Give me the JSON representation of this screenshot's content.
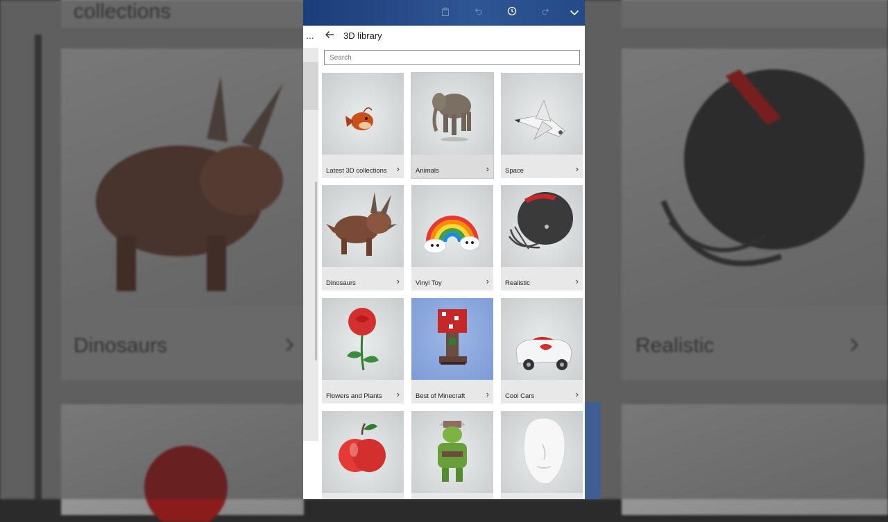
{
  "background": {
    "left_label_top": "collections",
    "left_label": "Dinosaurs",
    "right_label": "Realistic"
  },
  "toolbar": {
    "icons": [
      "paste-icon",
      "undo-icon",
      "history-icon",
      "redo-icon",
      "chevron-down-icon"
    ]
  },
  "panel": {
    "more_label": "...",
    "title": "3D library",
    "search_placeholder": "Search"
  },
  "categories": [
    {
      "label": "Latest 3D collections",
      "icon": "anglerfish-icon"
    },
    {
      "label": "Animals",
      "icon": "elephant-icon"
    },
    {
      "label": "Space",
      "icon": "space-shuttle-icon"
    },
    {
      "label": "Dinosaurs",
      "icon": "triceratops-icon"
    },
    {
      "label": "Vinyl Toy",
      "icon": "rainbow-icon"
    },
    {
      "label": "Realistic",
      "icon": "football-helmet-icon"
    },
    {
      "label": "Flowers and Plants",
      "icon": "rose-icon"
    },
    {
      "label": "Best of Minecraft",
      "icon": "mushroom-house-icon"
    },
    {
      "label": "Cool Cars",
      "icon": "toy-car-icon"
    },
    {
      "label": "",
      "icon": "apple-icon"
    },
    {
      "label": "",
      "icon": "orc-icon"
    },
    {
      "label": "",
      "icon": "head-model-icon"
    }
  ],
  "colors": {
    "topbar": "#2f5694",
    "card_bg": "#e8e8e8"
  }
}
